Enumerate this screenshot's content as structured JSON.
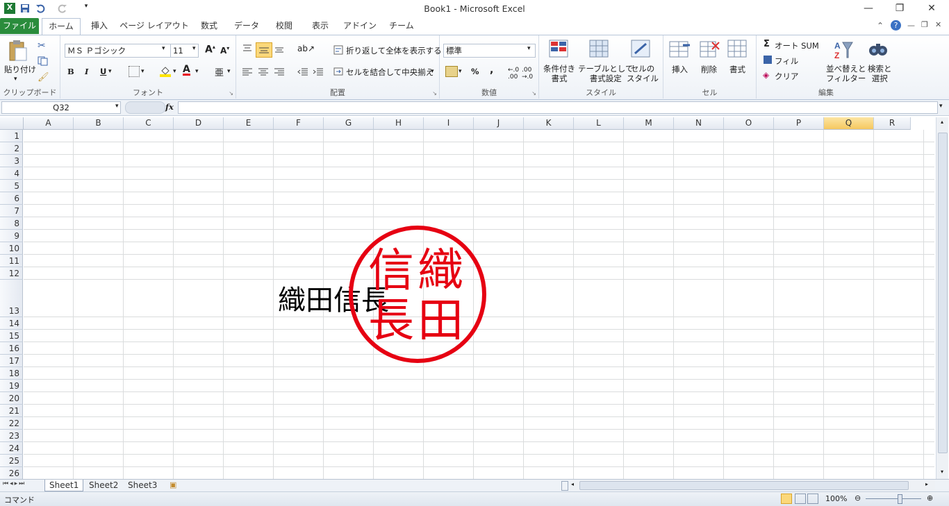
{
  "window": {
    "title": "Book1 - Microsoft Excel",
    "controls": {
      "minimize": "—",
      "restore": "❐",
      "close": "✕"
    }
  },
  "tabs": [
    "ファイル",
    "ホーム",
    "挿入",
    "ページ レイアウト",
    "数式",
    "データ",
    "校閲",
    "表示",
    "アドイン",
    "チーム"
  ],
  "ribbon": {
    "clipboard": {
      "paste": "貼り付け",
      "label": "クリップボード"
    },
    "font": {
      "name": "ＭＳ Ｐゴシック",
      "size": "11",
      "bold": "B",
      "italic": "I",
      "underline": "U",
      "label": "フォント"
    },
    "alignment": {
      "wrap": "折り返して全体を表示する",
      "merge": "セルを結合して中央揃え",
      "label": "配置"
    },
    "number": {
      "format": "標準",
      "percent": "%",
      "comma": ",",
      "label": "数値"
    },
    "styles": {
      "conditional": "条件付き\n書式",
      "table": "テーブルとして\n書式設定",
      "cell": "セルの\nスタイル",
      "label": "スタイル"
    },
    "cells": {
      "insert": "挿入",
      "delete": "削除",
      "format": "書式",
      "label": "セル"
    },
    "editing": {
      "autosum": "オート SUM",
      "fill": "フィル",
      "clear": "クリア",
      "sort": "並べ替えと\nフィルター",
      "find": "検索と\n選択",
      "label": "編集"
    }
  },
  "formula_bar": {
    "name_box": "Q32",
    "fx": "fx",
    "value": ""
  },
  "columns": [
    "A",
    "B",
    "C",
    "D",
    "E",
    "F",
    "G",
    "H",
    "I",
    "J",
    "K",
    "L",
    "M",
    "N",
    "O",
    "P",
    "Q",
    "R"
  ],
  "selected_column": "Q",
  "rows": [
    "1",
    "2",
    "3",
    "4",
    "5",
    "6",
    "7",
    "8",
    "9",
    "10",
    "11",
    "12",
    "13",
    "14",
    "15",
    "16",
    "17",
    "18",
    "19",
    "20",
    "21",
    "22",
    "23",
    "24",
    "25",
    "26"
  ],
  "cell_text": "織田信長",
  "stamp": {
    "chars": [
      "信",
      "織",
      "長",
      "田"
    ],
    "color": "#e60012"
  },
  "sheets": [
    "Sheet1",
    "Sheet2",
    "Sheet3"
  ],
  "active_sheet": "Sheet1",
  "status": {
    "mode": "コマンド",
    "zoom": "100%"
  }
}
